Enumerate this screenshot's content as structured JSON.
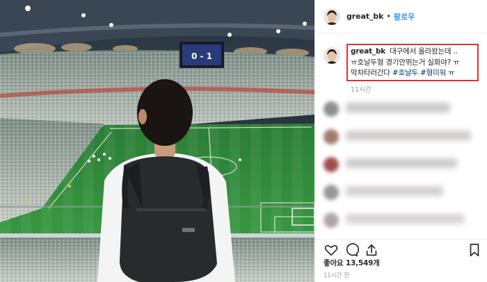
{
  "header": {
    "username": "great_bk",
    "separator": "•",
    "follow_label": "팔로우"
  },
  "scoreboard": {
    "score": "0 - 1"
  },
  "caption": {
    "username": "great_bk",
    "text": "대구에서 올라왔는데 .. ㅠ호날두형 경기안뛰는거 실화야? ㅠ 막차타러간다",
    "hashtag_1": "#호날두",
    "hashtag_2": "#형미워",
    "suffix": "ㅠ",
    "time": "11시간"
  },
  "comments": {
    "count_visible": 5,
    "blurred": true
  },
  "actions": {
    "icons": [
      "heart-icon",
      "comment-icon",
      "share-icon",
      "bookmark-icon"
    ]
  },
  "likes": {
    "label": "좋아요",
    "count": "13,549개"
  },
  "post_time": "11시간 전",
  "colors": {
    "follow_blue": "#3897f0",
    "hashtag_blue": "#003569",
    "highlight_red": "#e03030",
    "pitch_green": "#2f8a3a",
    "meta_gray": "#999999"
  }
}
